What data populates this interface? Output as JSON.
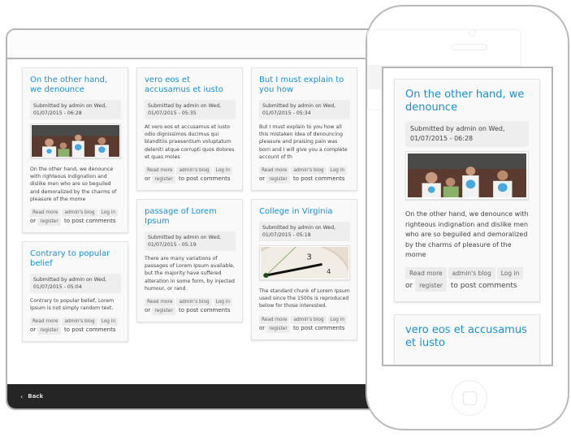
{
  "tablet": {
    "footer": {
      "back_label": "Back"
    }
  },
  "link_labels": {
    "read_more": "Read more",
    "blog": "admin's blog",
    "login": "Log in",
    "or": "or",
    "register": "register",
    "post_comments": "to post comments"
  },
  "posts": [
    {
      "title": "On the other hand, we denounce",
      "meta": "Submitted by admin on Wed, 01/07/2015 - 06:28",
      "image": "group-photo",
      "body": "On the other hand, we denounce with righteous indignation and dislike men who are so beguiled and demoralized by the charms of pleasure of the mome"
    },
    {
      "title": "Contrary to popular belief",
      "meta": "Submitted by admin on Wed, 01/07/2015 - 05:04",
      "image": "",
      "body": "Contrary to popular belief, Lorem Ipsum is not simply random text."
    },
    {
      "title": "vero eos et accusamus et iusto",
      "meta": "Submitted by admin on Wed, 01/07/2015 - 05:35",
      "image": "",
      "body": "At vero eos et accusamus et iusto odio dignissimos ducimus qui blanditiis praesentium voluptatum deleniti atque corrupti quos dolores et quas moles"
    },
    {
      "title": "passage of Lorem Ipsum",
      "meta": "Submitted by admin on Wed, 01/07/2015 - 05:19",
      "image": "",
      "body": "There are many variations of passages of Lorem Ipsum available, but the majority have suffered alteration in some form, by injected humour, or rand"
    },
    {
      "title": "But I must explain to you how",
      "meta": "Submitted by admin on Wed, 01/07/2015 - 05:34",
      "image": "",
      "body": "But I must explain to you how all this mistaken idea of denouncing pleasure and praising pain was born and I will give you a complete account of th"
    },
    {
      "title": "College in Virginia",
      "meta": "Submitted by admin on Wed, 01/07/2015 - 05:18",
      "image": "clock-photo",
      "body": "The standard chunk of Lorem Ipsum used since the 1500s is reproduced below for those interested."
    }
  ],
  "phone": {
    "posts": [
      {
        "title": "On the other hand, we denounce",
        "meta": "Submitted by admin on Wed, 01/07/2015 - 06:28",
        "body": "On the other hand, we denounce with righteous indignation and dislike men who are so beguiled and demoralized by the charms of pleasure of the mome"
      },
      {
        "title": "vero eos et accusamus et iusto"
      }
    ]
  }
}
